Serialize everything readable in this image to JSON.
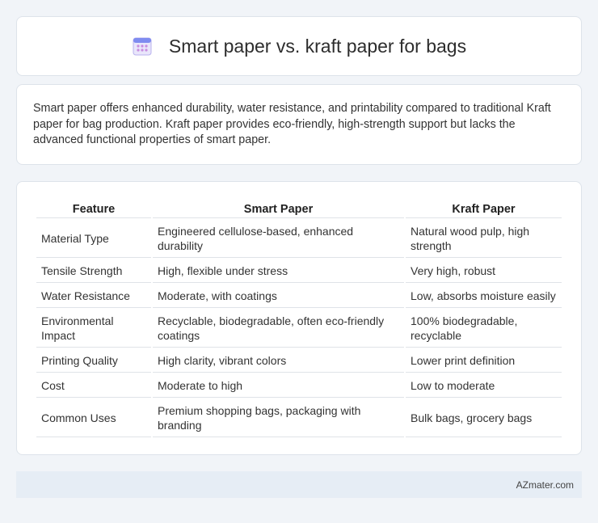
{
  "header": {
    "title": "Smart paper vs. kraft paper for bags",
    "icon": "calendar-grid-icon"
  },
  "summary": "Smart paper offers enhanced durability, water resistance, and printability compared to traditional Kraft paper for bag production. Kraft paper provides eco-friendly, high-strength support but lacks the advanced functional properties of smart paper.",
  "table": {
    "headers": [
      "Feature",
      "Smart Paper",
      "Kraft Paper"
    ],
    "rows": [
      [
        "Material Type",
        "Engineered cellulose-based, enhanced durability",
        "Natural wood pulp, high strength"
      ],
      [
        "Tensile Strength",
        "High, flexible under stress",
        "Very high, robust"
      ],
      [
        "Water Resistance",
        "Moderate, with coatings",
        "Low, absorbs moisture easily"
      ],
      [
        "Environmental Impact",
        "Recyclable, biodegradable, often eco-friendly coatings",
        "100% biodegradable, recyclable"
      ],
      [
        "Printing Quality",
        "High clarity, vibrant colors",
        "Lower print definition"
      ],
      [
        "Cost",
        "Moderate to high",
        "Low to moderate"
      ],
      [
        "Common Uses",
        "Premium shopping bags, packaging with branding",
        "Bulk bags, grocery bags"
      ]
    ]
  },
  "footer": {
    "source": "AZmater.com"
  }
}
